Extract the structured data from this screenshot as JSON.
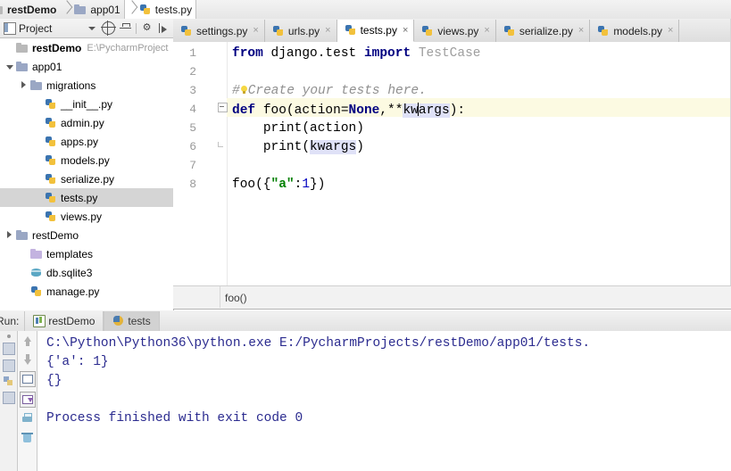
{
  "breadcrumb": {
    "items": [
      {
        "label": "restDemo",
        "icon": "folder-icon",
        "bold": true,
        "active": false
      },
      {
        "label": "app01",
        "icon": "folder-icon",
        "bold": false,
        "active": false
      },
      {
        "label": "tests.py",
        "icon": "python-file-icon",
        "bold": false,
        "active": true
      }
    ]
  },
  "project_panel": {
    "title": "Project",
    "toolbar": [
      {
        "name": "select-opens-file-caret",
        "glyph": ""
      },
      {
        "name": "scroll-from-source-icon",
        "glyph": ""
      },
      {
        "name": "collapse-all-icon",
        "glyph": ""
      },
      {
        "name": "settings-gear-icon",
        "glyph": "⚙"
      },
      {
        "name": "hide-icon",
        "glyph": ""
      }
    ],
    "tree": [
      {
        "indent": 0,
        "arrow": "none",
        "icon": "folder-icon",
        "label": "restDemo",
        "bold": true,
        "path": "E:\\PycharmProject",
        "selected": false
      },
      {
        "indent": 0,
        "arrow": "open",
        "icon": "folder-blue-icon",
        "label": "app01",
        "bold": false,
        "path": "",
        "selected": false
      },
      {
        "indent": 1,
        "arrow": "closed",
        "icon": "folder-blue-icon",
        "label": "migrations",
        "bold": false,
        "path": "",
        "selected": false
      },
      {
        "indent": 2,
        "arrow": "none",
        "icon": "python-file-icon",
        "label": "__init__.py",
        "bold": false,
        "path": "",
        "selected": false
      },
      {
        "indent": 2,
        "arrow": "none",
        "icon": "python-file-icon",
        "label": "admin.py",
        "bold": false,
        "path": "",
        "selected": false
      },
      {
        "indent": 2,
        "arrow": "none",
        "icon": "python-file-icon",
        "label": "apps.py",
        "bold": false,
        "path": "",
        "selected": false
      },
      {
        "indent": 2,
        "arrow": "none",
        "icon": "python-file-icon",
        "label": "models.py",
        "bold": false,
        "path": "",
        "selected": false
      },
      {
        "indent": 2,
        "arrow": "none",
        "icon": "python-file-icon",
        "label": "serialize.py",
        "bold": false,
        "path": "",
        "selected": false
      },
      {
        "indent": 2,
        "arrow": "none",
        "icon": "python-file-icon",
        "label": "tests.py",
        "bold": false,
        "path": "",
        "selected": true
      },
      {
        "indent": 2,
        "arrow": "none",
        "icon": "python-file-icon",
        "label": "views.py",
        "bold": false,
        "path": "",
        "selected": false
      },
      {
        "indent": 0,
        "arrow": "closed",
        "icon": "folder-blue-icon",
        "label": "restDemo",
        "bold": false,
        "path": "",
        "selected": false
      },
      {
        "indent": 1,
        "arrow": "none",
        "icon": "folder-violet-icon",
        "label": "templates",
        "bold": false,
        "path": "",
        "selected": false
      },
      {
        "indent": 1,
        "arrow": "none",
        "icon": "database-icon",
        "label": "db.sqlite3",
        "bold": false,
        "path": "",
        "selected": false
      },
      {
        "indent": 1,
        "arrow": "none",
        "icon": "python-file-icon",
        "label": "manage.py",
        "bold": false,
        "path": "",
        "selected": false
      }
    ]
  },
  "editor_tabs": [
    {
      "label": "settings.py",
      "active": false,
      "close": "×"
    },
    {
      "label": "urls.py",
      "active": false,
      "close": "×"
    },
    {
      "label": "tests.py",
      "active": true,
      "close": "×"
    },
    {
      "label": "views.py",
      "active": false,
      "close": "×"
    },
    {
      "label": "serialize.py",
      "active": false,
      "close": "×"
    },
    {
      "label": "models.py",
      "active": false,
      "close": "×"
    }
  ],
  "editor": {
    "filename": "tests.py",
    "current_line": 4,
    "line_numbers": [
      "1",
      "2",
      "3",
      "4",
      "5",
      "6",
      "7",
      "8"
    ],
    "lines": [
      "from django.test import TestCase",
      "",
      "# Create your tests here.",
      "def foo(action=None,**kwargs):",
      "    print(action)",
      "    print(kwargs)",
      "",
      "foo({\"a\":1})"
    ],
    "breadcrumb_status": "foo()"
  },
  "run_panel": {
    "label": "Run:",
    "tabs": [
      {
        "label": "restDemo",
        "icon": "idea-module-icon",
        "active": false
      },
      {
        "label": "tests",
        "icon": "python-run-icon",
        "active": true
      }
    ],
    "toolbar": [
      {
        "name": "up-the-stack-trace-icon"
      },
      {
        "name": "down-the-stack-trace-icon"
      },
      {
        "name": "soft-wrap-icon"
      },
      {
        "name": "scroll-to-end-icon"
      },
      {
        "name": "print-icon"
      },
      {
        "name": "clear-all-icon"
      }
    ],
    "console_lines": [
      "C:\\Python\\Python36\\python.exe E:/PycharmProjects/restDemo/app01/tests.",
      "{'a': 1}",
      "{}",
      "",
      "Process finished with exit code 0"
    ]
  },
  "colors": {
    "keyword": "#000080",
    "comment": "#909090",
    "string": "#008000",
    "number": "#0000c0",
    "console_text": "#2b2b8f",
    "current_line": "#fcfae2",
    "selection": "#dfe1f7"
  }
}
